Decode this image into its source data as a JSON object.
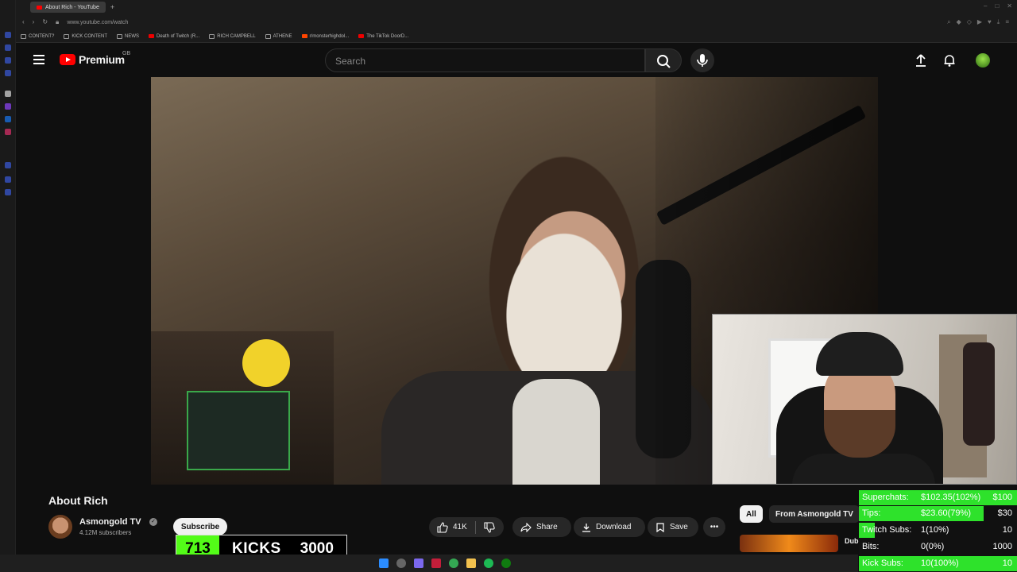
{
  "browser": {
    "tab_title": "About Rich - YouTube",
    "new_tab": "+",
    "address": "www.youtube.com/watch",
    "bookmarks": [
      "CONTENT?",
      "KICK CONTENT",
      "NEWS",
      "Death of Twitch (R...",
      "RICH CAMPBELL",
      "ATHENE",
      "r/monsterhighdol...",
      "The TikTok DoorD..."
    ]
  },
  "youtube": {
    "logo_text": "Premium",
    "region": "GB",
    "search_placeholder": "Search"
  },
  "video": {
    "title": "About Rich",
    "channel": "Asmongold TV",
    "subscribers": "4.12M subscribers",
    "subscribe_label": "Subscribe",
    "likes": "41K",
    "share_label": "Share",
    "download_label": "Download",
    "save_label": "Save",
    "more_label": "•••"
  },
  "sidebar_chips": {
    "all": "All",
    "from": "From Asmongold TV",
    "next_title": "Dub"
  },
  "kick_counter": {
    "count": "713",
    "label": "KICKS",
    "goal": "3000"
  },
  "tracker": {
    "rows": [
      {
        "label": "Superchats:",
        "value": "$102.35(102%)",
        "goal": "$100",
        "fill": 1.0
      },
      {
        "label": "Tips:",
        "value": "$23.60(79%)",
        "goal": "$30",
        "fill": 0.79
      },
      {
        "label": "Twitch Subs:",
        "value": "1(10%)",
        "goal": "10",
        "fill": 0.1
      },
      {
        "label": "Bits:",
        "value": "0(0%)",
        "goal": "1000",
        "fill": 0.0
      },
      {
        "label": "Kick Subs:",
        "value": "10(100%)",
        "goal": "10",
        "fill": 1.0
      }
    ]
  },
  "colors": {
    "youtube_red": "#ff0000",
    "kick_green": "#53fc18",
    "tracker_green": "#2ee22b",
    "background": "#0f0f0f"
  }
}
